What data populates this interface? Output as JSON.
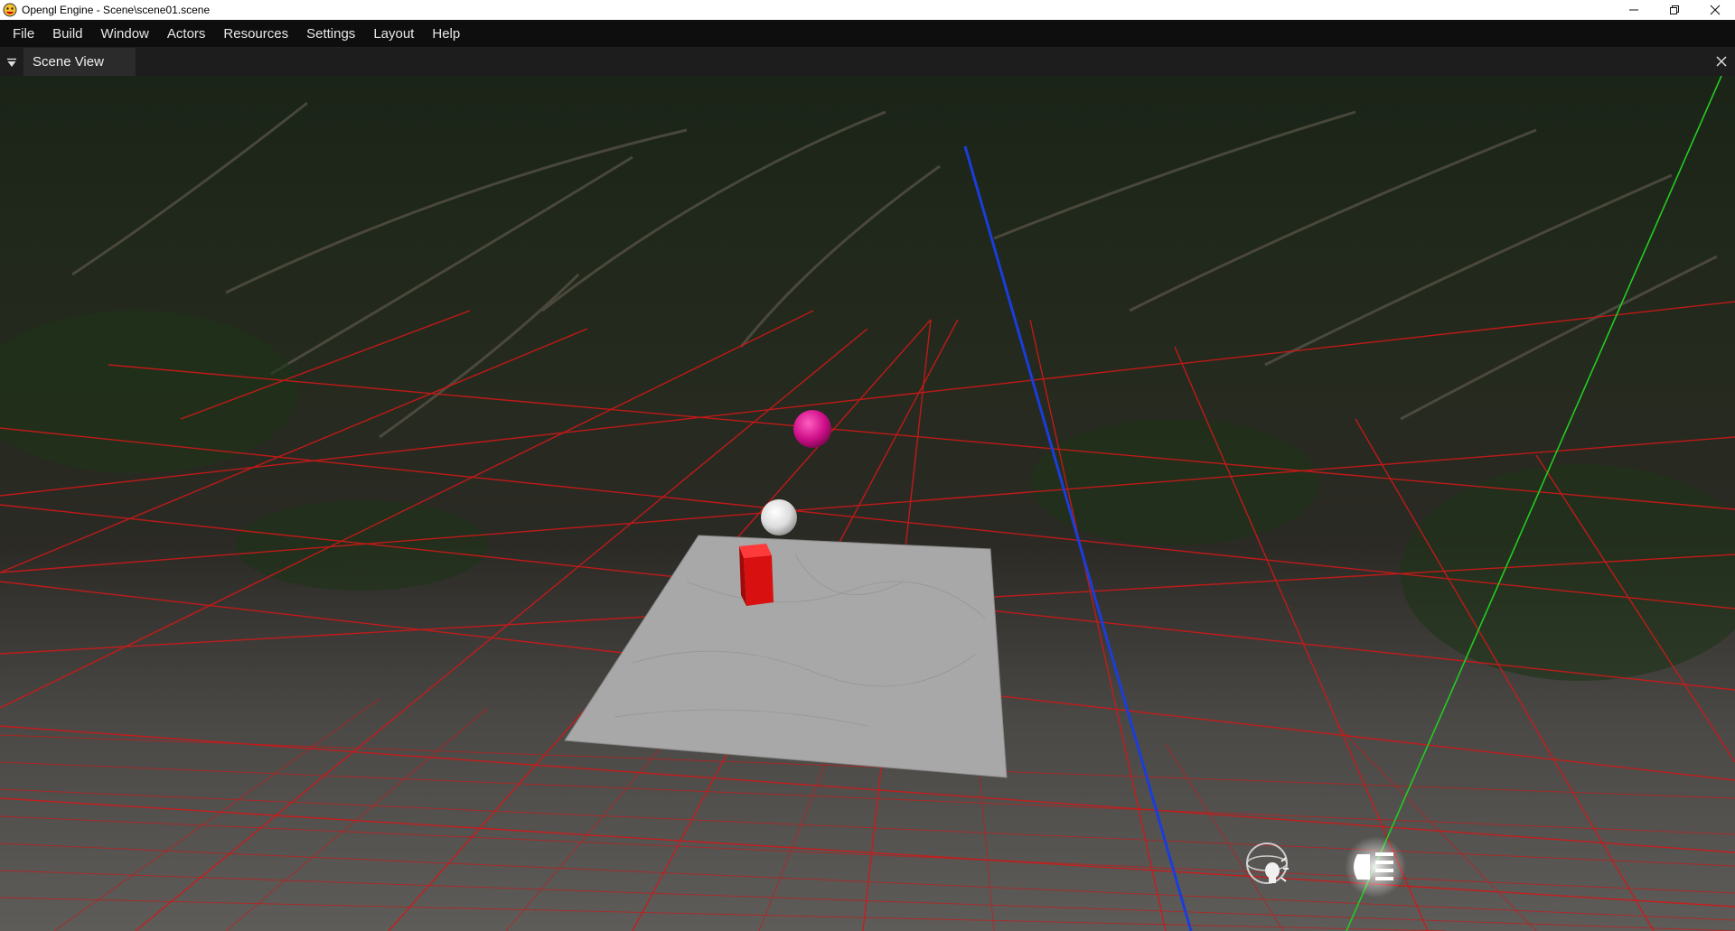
{
  "window": {
    "title": "Opengl Engine - Scene\\scene01.scene",
    "app_icon": "smiley-icon",
    "controls": [
      "minimize-icon",
      "restore-icon",
      "close-icon"
    ]
  },
  "menu": {
    "items": [
      {
        "label": "File"
      },
      {
        "label": "Build"
      },
      {
        "label": "Window"
      },
      {
        "label": "Actors"
      },
      {
        "label": "Resources"
      },
      {
        "label": "Settings"
      },
      {
        "label": "Layout"
      },
      {
        "label": "Help"
      }
    ]
  },
  "panel": {
    "tab_label": "Scene View",
    "collapse_icon": "triangle-down-icon",
    "close_icon": "close-icon"
  },
  "scene": {
    "grid_color": "#d01818",
    "axis_y_color": "#22cc22",
    "axis_z_color": "#1a3ddb",
    "plane_color": "#a8a8a8",
    "cube_color": "#d81010",
    "sphere_magenta_color": "#d0108a",
    "sphere_white_color": "#e8e8e8",
    "overlay_buttons": [
      "light-bulb-gizmo-icon",
      "headlight-icon"
    ]
  }
}
